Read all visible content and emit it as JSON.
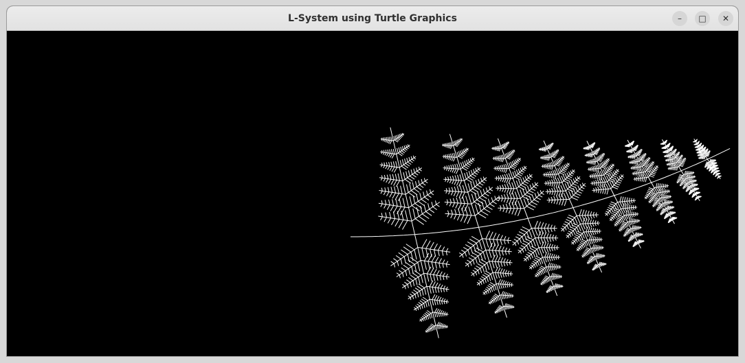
{
  "window": {
    "title": "L-System using Turtle Graphics",
    "controls": {
      "minimize_symbol": "–",
      "maximize_symbol": "□",
      "close_symbol": "✕"
    }
  },
  "canvas": {
    "background_color": "#000000",
    "stroke_color": "#ffffff",
    "drawing": "fern fractal"
  }
}
